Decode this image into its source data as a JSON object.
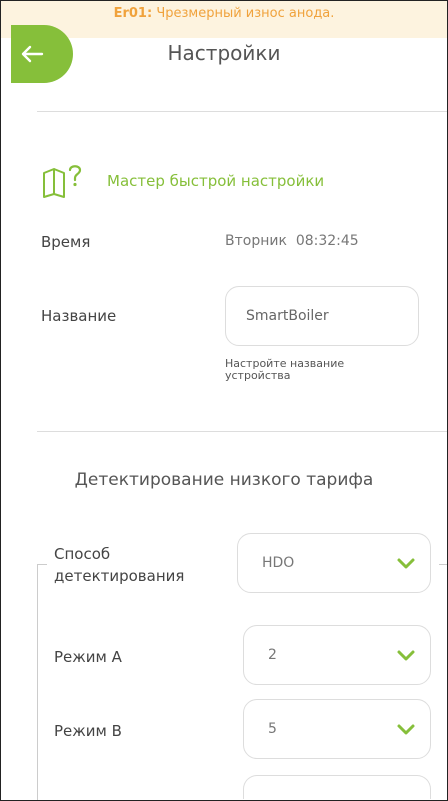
{
  "error": {
    "code": "Er01:",
    "message": "Чрезмерный износ анода."
  },
  "header": {
    "title": "Настройки"
  },
  "wizard": {
    "label": "Мастер быстрой настройки"
  },
  "time": {
    "label": "Время",
    "value": "Вторник  08:32:45"
  },
  "device_name": {
    "label": "Название",
    "value": "SmartBoiler",
    "hint": "Настройте название устройства"
  },
  "low_tariff": {
    "title": "Детектирование низкого тарифа",
    "method": {
      "label": "Способ детектирования",
      "value": "HDO"
    },
    "mode_a": {
      "label": "Режим A",
      "value": "2"
    },
    "mode_b": {
      "label": "Режим B",
      "value": "5"
    }
  },
  "colors": {
    "accent": "#86bf3a",
    "error": "#f0a23c",
    "banner_bg": "#fdf3df"
  }
}
